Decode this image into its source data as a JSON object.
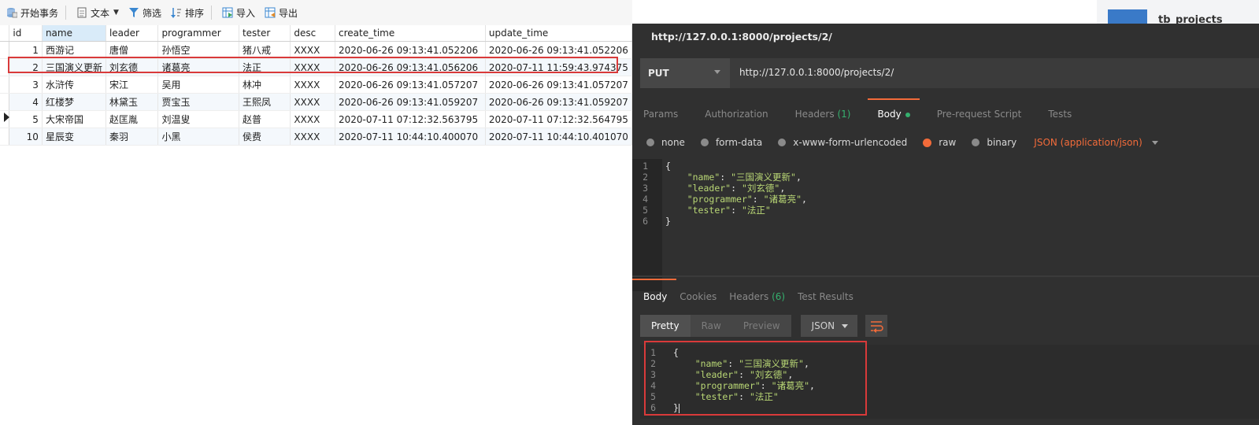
{
  "toolbar": {
    "begin_transaction": "开始事务",
    "text": "文本",
    "filter": "筛选",
    "sort": "排序",
    "import": "导入",
    "export": "导出"
  },
  "grid": {
    "columns": [
      "id",
      "name",
      "leader",
      "programmer",
      "tester",
      "desc",
      "create_time",
      "update_time"
    ],
    "rows": [
      [
        "1",
        "西游记",
        "唐僧",
        "孙悟空",
        "猪八戒",
        "XXXX",
        "2020-06-26 09:13:41.052206",
        "2020-06-26 09:13:41.052206"
      ],
      [
        "2",
        "三国演义更新",
        "刘玄德",
        "诸葛亮",
        "法正",
        "XXXX",
        "2020-06-26 09:13:41.056206",
        "2020-07-11 11:59:43.974375"
      ],
      [
        "3",
        "水浒传",
        "宋江",
        "吴用",
        "林冲",
        "XXXX",
        "2020-06-26 09:13:41.057207",
        "2020-06-26 09:13:41.057207"
      ],
      [
        "4",
        "红楼梦",
        "林黛玉",
        "贾宝玉",
        "王熙凤",
        "XXXX",
        "2020-06-26 09:13:41.059207",
        "2020-06-26 09:13:41.059207"
      ],
      [
        "5",
        "大宋帝国",
        "赵匡胤",
        "刘温叟",
        "赵普",
        "XXXX",
        "2020-07-11 07:12:32.563795",
        "2020-07-11 07:12:32.564795"
      ],
      [
        "10",
        "星辰变",
        "秦羽",
        "小黑",
        "侯费",
        "XXXX",
        "2020-07-11 10:44:10.400070",
        "2020-07-11 10:44:10.401070"
      ]
    ]
  },
  "right_strip": {
    "title": "tb_projects"
  },
  "postman": {
    "title": "http://127.0.0.1:8000/projects/2/",
    "method": "PUT",
    "url": "http://127.0.0.1:8000/projects/2/",
    "request_tabs": {
      "params": "Params",
      "authorization": "Authorization",
      "headers": "Headers",
      "headers_count": "(1)",
      "body": "Body",
      "prerequest": "Pre-request Script",
      "tests": "Tests"
    },
    "body_options": {
      "none": "none",
      "form_data": "form-data",
      "urlencoded": "x-www-form-urlencoded",
      "raw": "raw",
      "binary": "binary",
      "json_type": "JSON (application/json)"
    },
    "request_body": {
      "line_numbers": [
        "1",
        "2",
        "3",
        "4",
        "5",
        "6"
      ],
      "open": "{",
      "fields": [
        {
          "key": "\"name\"",
          "value": "\"三国演义更新\"",
          "sep": ","
        },
        {
          "key": "\"leader\"",
          "value": "\"刘玄德\"",
          "sep": ","
        },
        {
          "key": "\"programmer\"",
          "value": "\"诸葛亮\"",
          "sep": ","
        },
        {
          "key": "\"tester\"",
          "value": "\"法正\"",
          "sep": ""
        }
      ],
      "close": "}"
    },
    "response_tabs": {
      "body": "Body",
      "cookies": "Cookies",
      "headers": "Headers",
      "headers_count": "(6)",
      "test_results": "Test Results"
    },
    "view": {
      "pretty": "Pretty",
      "raw": "Raw",
      "preview": "Preview",
      "format": "JSON"
    },
    "response_body": {
      "line_numbers": [
        "1",
        "2",
        "3",
        "4",
        "5",
        "6"
      ],
      "open": "{",
      "fields": [
        {
          "key": "\"name\"",
          "value": "\"三国演义更新\"",
          "sep": ","
        },
        {
          "key": "\"leader\"",
          "value": "\"刘玄德\"",
          "sep": ","
        },
        {
          "key": "\"programmer\"",
          "value": "\"诸葛亮\"",
          "sep": ","
        },
        {
          "key": "\"tester\"",
          "value": "\"法正\"",
          "sep": ""
        }
      ],
      "close": "}"
    }
  },
  "colors": {
    "accent": "#f26b3a",
    "highlight_box": "#d93a3a",
    "green": "#35b06e"
  }
}
